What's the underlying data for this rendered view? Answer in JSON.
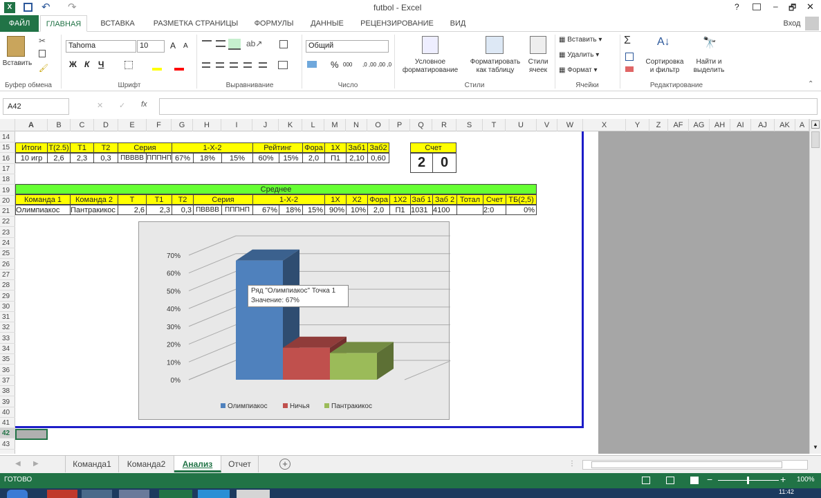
{
  "window": {
    "title": "futbol - Excel",
    "help": "?",
    "minimize": "–",
    "restore": "🗗",
    "close": "✕"
  },
  "qat": {
    "undo": "↶",
    "redo": "↷"
  },
  "ribbon_tabs": [
    "ФАЙЛ",
    "ГЛАВНАЯ",
    "ВСТАВКА",
    "РАЗМЕТКА СТРАНИЦЫ",
    "ФОРМУЛЫ",
    "ДАННЫЕ",
    "РЕЦЕНЗИРОВАНИЕ",
    "ВИД"
  ],
  "signin": "Вход",
  "ribbon": {
    "paste": "Вставить",
    "font_name": "Tahoma",
    "font_size": "10",
    "bold": "Ж",
    "italic": "К",
    "underline": "Ч",
    "grow": "A",
    "shrink": "A",
    "number_format": "Общий",
    "percent": "%",
    "thousands": "000",
    "inc_dec": ",0 ,00",
    "dec_dec": ",00 ,0",
    "cond_format": "Условное форматирование",
    "format_table": "Форматировать как таблицу",
    "cell_styles": "Стили ячеек",
    "insert": "Вставить",
    "delete": "Удалить",
    "format": "Формат",
    "sort": "Сортировка и фильтр",
    "find": "Найти и выделить",
    "groups": [
      "Буфер обмена",
      "Шрифт",
      "Выравнивание",
      "Число",
      "Стили",
      "Ячейки",
      "Редактирование"
    ]
  },
  "formula_bar": {
    "name_box": "A42",
    "fx": "fx",
    "value": ""
  },
  "columns": [
    "A",
    "B",
    "C",
    "D",
    "E",
    "F",
    "G",
    "H",
    "I",
    "J",
    "K",
    "L",
    "M",
    "N",
    "O",
    "P",
    "Q",
    "R",
    "S",
    "T",
    "U",
    "V",
    "W",
    "X",
    "Y",
    "Z",
    "AF",
    "AG",
    "AH",
    "AI",
    "AJ",
    "AK",
    "A"
  ],
  "rows": [
    "14",
    "15",
    "16",
    "17",
    "18",
    "19",
    "20",
    "21",
    "22",
    "23",
    "24",
    "25",
    "26",
    "27",
    "28",
    "29",
    "30",
    "31",
    "32",
    "33",
    "34",
    "35",
    "36",
    "37",
    "38",
    "39",
    "40",
    "41",
    "42",
    "43"
  ],
  "table1": {
    "headers": [
      "Итоги",
      "Т(2.5)",
      "Т1",
      "Т2",
      "Серия",
      "1-Х-2",
      "Рейтинг",
      "Фора",
      "1Х",
      "Заб1",
      "Заб2"
    ],
    "values": [
      "10 игр",
      "2,6",
      "2,3",
      "0,3",
      "ПВВВВ",
      "ПППНП",
      "67%",
      "18%",
      "15%",
      "60%",
      "15%",
      "2,0",
      "П1",
      "2,10",
      "0,60"
    ]
  },
  "score": {
    "label": "Счет",
    "home": "2",
    "away": "0"
  },
  "table2": {
    "title": "Среднее",
    "headers": [
      "Команда 1",
      "Команда 2",
      "Т",
      "Т1",
      "Т2",
      "Серия",
      "1-Х-2",
      "1Х",
      "Х2",
      "Фора",
      "1Х2",
      "Заб 1",
      "Заб 2",
      "Тотал",
      "Счет",
      "ТБ(2,5)"
    ],
    "values": [
      "Олимпиакос",
      "Пантракикос",
      "2,6",
      "2,3",
      "0,3",
      "ПВВВВ",
      "ПППНП",
      "67%",
      "18%",
      "15%",
      "90%",
      "10%",
      "2,0",
      "П1",
      "1031",
      "4100",
      "",
      "2:0",
      "0%"
    ]
  },
  "chart_data": {
    "type": "bar",
    "categories": [
      ""
    ],
    "series": [
      {
        "name": "Олимпиакос",
        "values": [
          67
        ]
      },
      {
        "name": "Ничья",
        "values": [
          18
        ]
      },
      {
        "name": "Пантракикос",
        "values": [
          15
        ]
      }
    ],
    "ylim": [
      0,
      70
    ],
    "yticks": [
      "0%",
      "10%",
      "20%",
      "30%",
      "40%",
      "50%",
      "60%",
      "70%"
    ],
    "legend": "bottom",
    "colors": [
      "#4f81bd",
      "#c0504d",
      "#9bbb59"
    ],
    "tooltip": [
      "Ряд \"Олимпиакос\" Точка 1",
      "Значение: 67%"
    ]
  },
  "sheets": [
    "Команда1",
    "Команда2",
    "Анализ",
    "Отчет"
  ],
  "active_sheet": "Анализ",
  "status": {
    "ready": "ГОТОВО",
    "zoom": "100%"
  },
  "clock": "11:42"
}
